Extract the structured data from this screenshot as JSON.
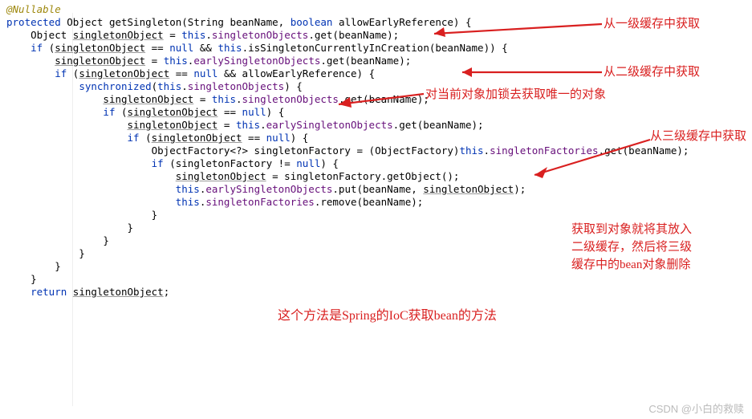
{
  "code": {
    "annotation": "@Nullable",
    "l1a": "protected",
    "l1b": "Object",
    "l1c": "getSingleton",
    "l1d": "(String beanName, ",
    "l1e": "boolean",
    "l1f": " allowEarlyReference) {",
    "l2a": "    Object ",
    "l2u": "singletonObject",
    "l2b": " = ",
    "l2kw": "this",
    "l2c": ".",
    "l2f": "singletonObjects",
    "l2d": ".get(beanName);",
    "l3a": "    ",
    "l3kw1": "if",
    "l3b": " (",
    "l3u": "singletonObject",
    "l3c": " == ",
    "l3kw2": "null",
    "l3d": " && ",
    "l3kw3": "this",
    "l3e": ".isSingletonCurrentlyInCreation(beanName)) {",
    "l4a": "        ",
    "l4u": "singletonObject",
    "l4b": " = ",
    "l4kw": "this",
    "l4c": ".",
    "l4f": "earlySingletonObjects",
    "l4d": ".get(beanName);",
    "l5a": "        ",
    "l5kw1": "if",
    "l5b": " (",
    "l5u": "singletonObject",
    "l5c": " == ",
    "l5kw2": "null",
    "l5d": " && allowEarlyReference) {",
    "l6a": "            ",
    "l6kw1": "synchronized",
    "l6b": "(",
    "l6kw2": "this",
    "l6c": ".",
    "l6f": "singletonObjects",
    "l6d": ") {",
    "l7a": "                ",
    "l7u": "singletonObject",
    "l7b": " = ",
    "l7kw": "this",
    "l7c": ".",
    "l7f": "singletonObjects",
    "l7d": ".get(beanName);",
    "l8a": "                ",
    "l8kw1": "if",
    "l8b": " (",
    "l8u": "singletonObject",
    "l8c": " == ",
    "l8kw2": "null",
    "l8d": ") {",
    "l9a": "                    ",
    "l9u": "singletonObject",
    "l9b": " = ",
    "l9kw": "this",
    "l9c": ".",
    "l9f": "earlySingletonObjects",
    "l9d": ".get(beanName);",
    "l10a": "                    ",
    "l10kw1": "if",
    "l10b": " (",
    "l10u": "singletonObject",
    "l10c": " == ",
    "l10kw2": "null",
    "l10d": ") {",
    "l11a": "                        ObjectFactory<?> singletonFactory = (ObjectFactory)",
    "l11kw": "this",
    "l11b": ".",
    "l11f": "singletonFactories",
    "l11c": ".get(beanName);",
    "l12a": "                        ",
    "l12kw1": "if",
    "l12b": " (singletonFactory != ",
    "l12kw2": "null",
    "l12c": ") {",
    "l13a": "                            ",
    "l13u": "singletonObject",
    "l13b": " = singletonFactory.getObject();",
    "l14a": "                            ",
    "l14kw": "this",
    "l14b": ".",
    "l14f": "earlySingletonObjects",
    "l14c": ".put(beanName, ",
    "l14u": "singletonObject",
    "l14d": ");",
    "l15a": "                            ",
    "l15kw": "this",
    "l15b": ".",
    "l15f": "singletonFactories",
    "l15c": ".remove(beanName);",
    "l16": "                        }",
    "l17": "                    }",
    "l18": "                }",
    "l19": "            }",
    "l20": "        }",
    "l21": "    }",
    "blank": "",
    "l22a": "    ",
    "l22kw": "return",
    "l22b": " ",
    "l22u": "singletonObject",
    "l22c": ";"
  },
  "notes": {
    "n1": "从一级缓存中获取",
    "n2": "从二级缓存中获取",
    "n3": "对当前对象加锁去获取唯一的对象",
    "n4": "从三级缓存中获取",
    "n5a": "获取到对象就将其放入",
    "n5b": "二级缓存，然后将三级",
    "n5c": "缓存中的bean对象删除",
    "n6": "这个方法是Spring的IoC获取bean的方法"
  },
  "watermark": "CSDN @小白的救赎"
}
